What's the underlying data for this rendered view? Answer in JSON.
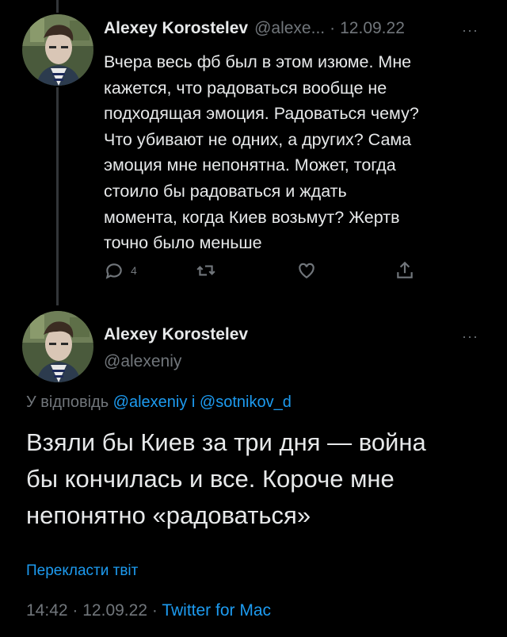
{
  "tweet1": {
    "author_name": "Alexey Korostelev",
    "handle_truncated": "@alexe...",
    "separator": "·",
    "date": "12.09.22",
    "more": "···",
    "text": "Вчера весь фб был в этом изюме. Мне\nкажется, что радоваться вообще не\nподходящая эмоция. Радоваться чему?\nЧто убивают не одних, а других? Сама\nэмоция мне непонятна. Может, тогда\nстоило бы радоваться и ждать\nмомента, когда Киев возьмут? Жертв\nточно было меньше",
    "reply_count": "4",
    "icons": [
      "reply-icon",
      "retweet-icon",
      "like-icon",
      "share-icon"
    ]
  },
  "tweet2": {
    "author_name": "Alexey Korostelev",
    "handle": "@alexeniy",
    "more": "···",
    "reply_prefix": "У відповідь ",
    "reply_user1": "@alexeniy",
    "reply_joiner": " і ",
    "reply_user2": "@sotnikov_d",
    "text": "Взяли бы Киев за три дня — война\nбы кончилась и все. Короче мне\nнепонятно «радоваться»",
    "translate_label": "Перекласти твіт",
    "time": "14:42",
    "separator": "·",
    "date": "12.09.22",
    "client": "Twitter for Mac"
  },
  "colors": {
    "background": "#000000",
    "text": "#e7e9ea",
    "secondary": "#71767b",
    "accent": "#1d9bf0",
    "thread_line": "#333639"
  }
}
